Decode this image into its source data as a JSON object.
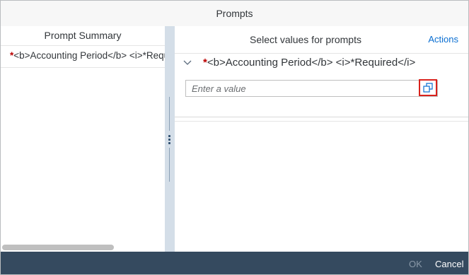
{
  "dialog": {
    "title": "Prompts"
  },
  "left_pane": {
    "header": "Prompt Summary",
    "items": [
      {
        "required_marker": "*",
        "label": "<b>Accounting Period</b> <i>*Required</i>"
      }
    ]
  },
  "right_pane": {
    "header": "Select values for prompts",
    "actions_label": "Actions",
    "prompt": {
      "required_marker": "*",
      "label": "<b>Accounting Period</b> <i>*Required</i>",
      "input_placeholder": "Enter a value",
      "input_value": "",
      "value_help_icon": "value-help-icon"
    }
  },
  "footer": {
    "ok_label": "OK",
    "cancel_label": "Cancel"
  },
  "colors": {
    "footer_bg": "#354a5f",
    "link": "#0a6ed1",
    "required": "#bb0000",
    "highlight_border": "#d9221c"
  }
}
